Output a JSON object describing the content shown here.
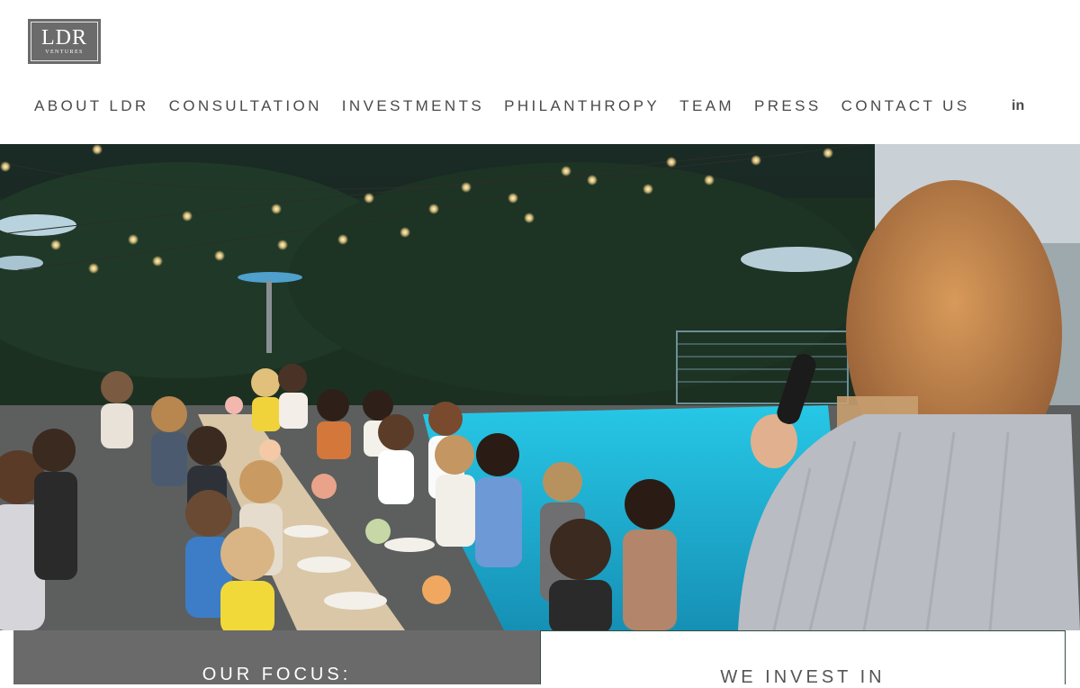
{
  "header": {
    "logo": {
      "text": "LDR",
      "subtext": "VENTURES"
    },
    "nav": [
      {
        "label": "ABOUT LDR"
      },
      {
        "label": "CONSULTATION"
      },
      {
        "label": "INVESTMENTS"
      },
      {
        "label": "PHILANTHROPY"
      },
      {
        "label": "TEAM"
      },
      {
        "label": "PRESS"
      },
      {
        "label": "CONTACT US"
      }
    ],
    "social": {
      "label": "in",
      "icon": "linkedin-icon"
    }
  },
  "sections": {
    "focus_title": "OUR FOCUS:",
    "invest_title": "WE INVEST IN"
  },
  "colors": {
    "nav_text": "#4a4a4a",
    "logo_bg": "#6b6b6b",
    "focus_panel": "#6a6a6a",
    "invest_border": "#2f4f3f",
    "pool": "#1fb4d6"
  }
}
